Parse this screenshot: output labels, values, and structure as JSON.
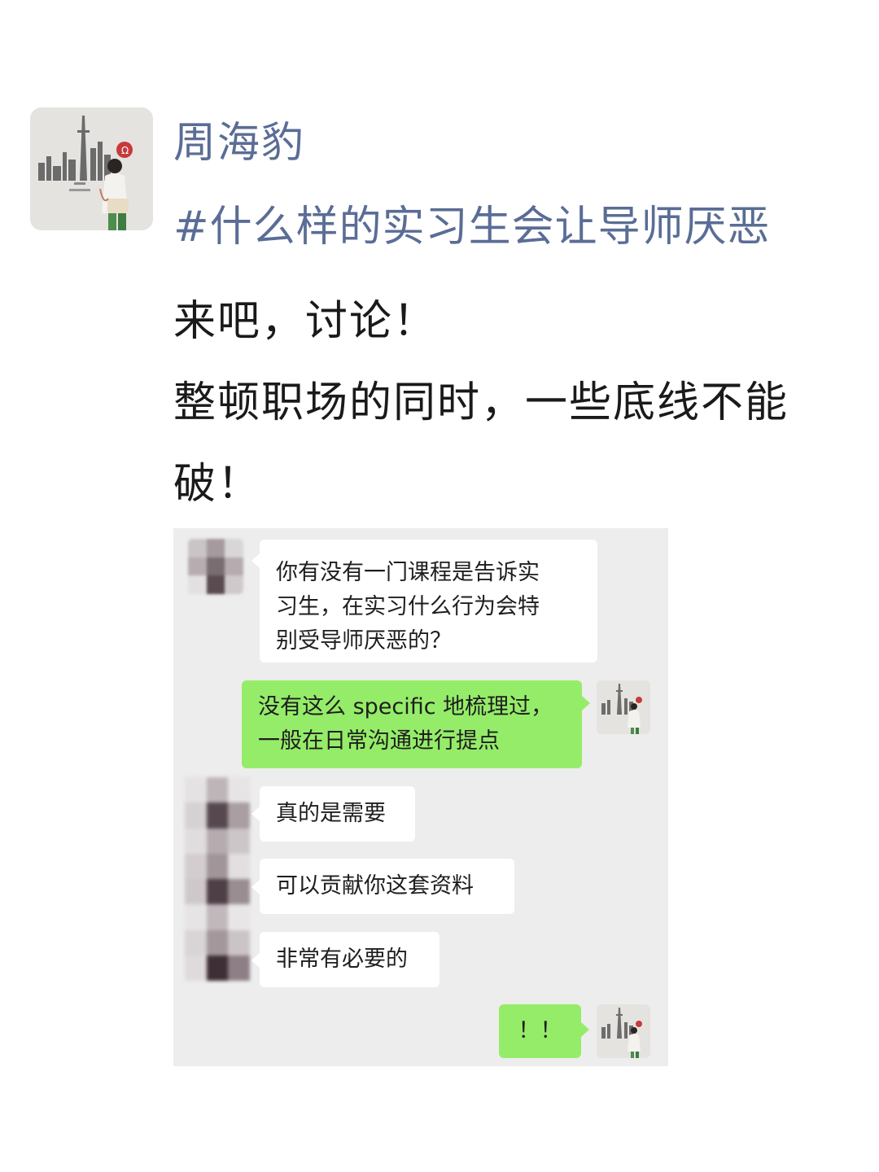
{
  "post": {
    "author": "周海豹",
    "hashtag": "#什么样的实习生会让导师厌恶",
    "body_line1": "来吧，讨论！",
    "body_line2": "整顿职场的同时，一些底线不能破！"
  },
  "chat": {
    "messages": [
      {
        "side": "in",
        "text": "你有没有一门课程是告诉实\n习生，在实习什么行为会特\n别受导师厌恶的？"
      },
      {
        "side": "out",
        "text": "没有这么 specific 地梳理过，\n一般在日常沟通进行提点"
      },
      {
        "side": "in",
        "text": "真的是需要"
      },
      {
        "side": "in",
        "text": "可以贡献你这套资料"
      },
      {
        "side": "in",
        "text": "非常有必要的"
      },
      {
        "side": "out",
        "text": "！！"
      }
    ]
  },
  "colors": {
    "author_link": "#5a6d96",
    "chat_background": "#ededed",
    "incoming_bubble": "#ffffff",
    "outgoing_bubble": "#95ec69"
  },
  "icons": {
    "post_avatar": "profile-photo-icon",
    "sender_avatar": "pixelated-avatar-icon",
    "self_avatar": "profile-photo-icon"
  }
}
